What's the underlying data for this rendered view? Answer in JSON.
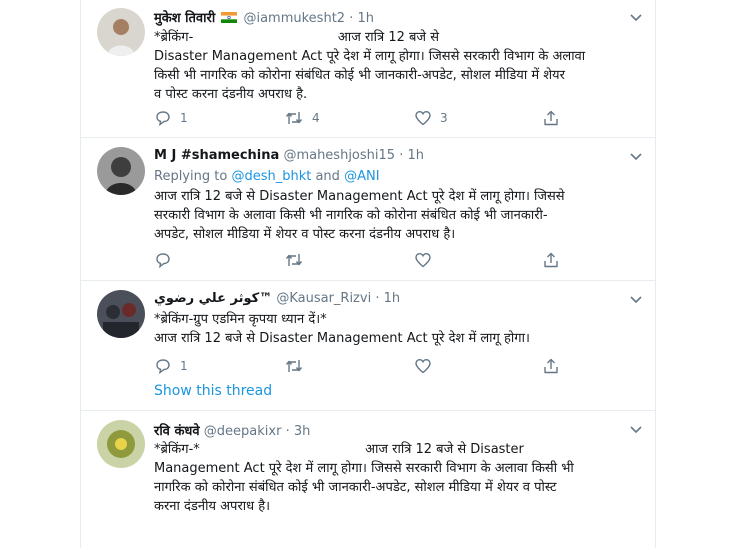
{
  "tweets": [
    {
      "name": "मुकेश तिवारी",
      "handle": "@iammukesht2",
      "sep": "·",
      "time": "1h",
      "lines": [
        "*ब्रेकिंग-                                   आज रात्रि 12 बजे से",
        "Disaster Management Act पूरे देश में लागू होगा। जिससे सरकारी विभाग के अलावा",
        "किसी भी नागरिक को कोरोना संबंधित कोई भी जानकारी-अपडेट, सोशल मीडिया में शेयर",
        "व पोस्ट करना दंडनीय अपराध है."
      ],
      "counts": {
        "reply": "1",
        "retweet": "4",
        "like": "3"
      }
    },
    {
      "name": "M J #shamechina",
      "handle": "@maheshjoshi15",
      "sep": "·",
      "time": "1h",
      "replying_to": "Replying to",
      "mention_1": "@desh_bhkt",
      "and": "and",
      "mention_2": "@ANI",
      "lines": [
        "आज रात्रि 12 बजे से Disaster Management Act पूरे देश में लागू होगा। जिससे",
        "सरकारी विभाग के अलावा किसी भी नागरिक को कोरोना संबंधित कोई भी जानकारी-",
        "अपडेट, सोशल मीडिया में शेयर व पोस्ट करना दंडनीय अपराध है।"
      ],
      "counts": {
        "reply": "",
        "retweet": "",
        "like": ""
      }
    },
    {
      "name": "كوثر علي رضوي™",
      "handle": "@Kausar_Rizvi",
      "sep": "·",
      "time": "1h",
      "lines": [
        "*ब्रेकिंग-ग्रुप एडमिन कृपया ध्यान दें।*",
        "आज रात्रि 12 बजे से Disaster Management Act पूरे देश में लागू होगा।"
      ],
      "counts": {
        "reply": "1",
        "retweet": "",
        "like": ""
      },
      "show_thread": "Show this thread"
    },
    {
      "name": "रवि कंधवे",
      "handle": "@deepakixr",
      "sep": "·",
      "time": "3h",
      "lines": [
        "*ब्रेकिंग-*                                        आज रात्रि 12 बजे से Disaster",
        "Management Act पूरे देश में लागू होगा। जिससे सरकारी विभाग के अलावा किसी भी",
        "नागरिक को कोरोना संबंधित कोई भी जानकारी-अपडेट, सोशल मीडिया में शेयर व पोस्ट",
        "करना दंडनीय अपराध है।"
      ]
    }
  ],
  "icons": {
    "reply": "reply-icon",
    "retweet": "retweet-icon",
    "like": "like-icon",
    "share": "share-icon",
    "more": "chevron-down-icon",
    "flag": "india-flag-icon"
  },
  "colors": {
    "text": "#14171a",
    "secondary": "#657786",
    "link": "#1b95e0",
    "divider": "#e6ecf0"
  }
}
